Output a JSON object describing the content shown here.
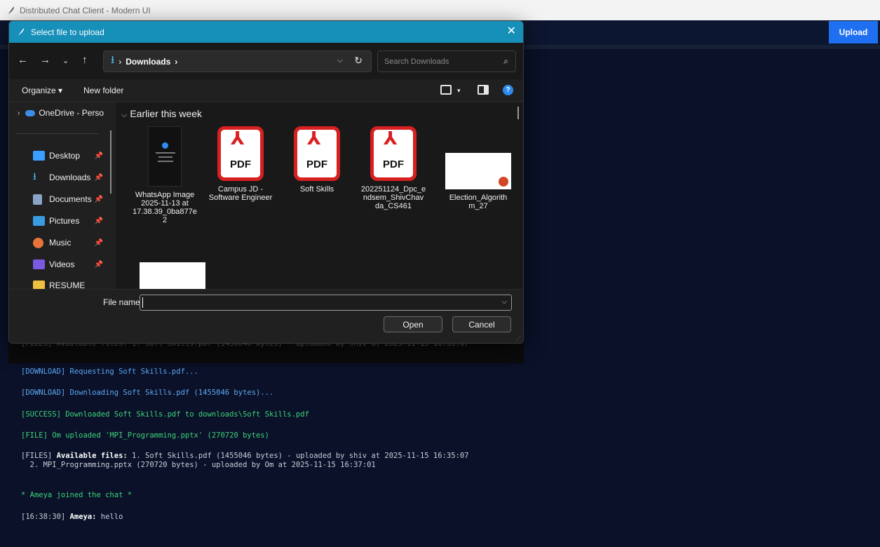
{
  "window": {
    "title": "Distributed Chat Client - Modern UI"
  },
  "app": {
    "upload_label": "Upload"
  },
  "dialog": {
    "title": "Select file to upload",
    "close": "✕",
    "address": {
      "folder": "Downloads",
      "sep_after": "›"
    },
    "search_placeholder": "Search Downloads",
    "commands": {
      "organize": "Organize ▾",
      "new_folder": "New folder"
    },
    "sidebar": [
      {
        "label": "OneDrive - Perso",
        "icon": "onedrive-icon",
        "color": "#3a8ee6"
      },
      {
        "label": "Desktop",
        "icon": "desktop-icon",
        "color": "#3aa0ff"
      },
      {
        "label": "Downloads",
        "icon": "download-icon",
        "color": "#4cc2ff"
      },
      {
        "label": "Documents",
        "icon": "documents-icon",
        "color": "#8aa4c8"
      },
      {
        "label": "Pictures",
        "icon": "pictures-icon",
        "color": "#3a9be0"
      },
      {
        "label": "Music",
        "icon": "music-icon",
        "color": "#e8743b"
      },
      {
        "label": "Videos",
        "icon": "videos-icon",
        "color": "#7a5ae0"
      },
      {
        "label": "RESUME",
        "icon": "folder-icon",
        "color": "#f0c040"
      }
    ],
    "group_header": "Earlier this week",
    "files": [
      {
        "name": "WhatsApp Image 2025-11-13 at 17.38.39_0ba877e 2",
        "kind": "image"
      },
      {
        "name": "Campus JD - Software Engineer",
        "kind": "pdf"
      },
      {
        "name": "Soft Skills",
        "kind": "pdf"
      },
      {
        "name": "202251124_Dpc_e ndsem_ShivChav da_CS461",
        "kind": "pdf"
      },
      {
        "name": "Election_Algorith m_27",
        "kind": "pptx"
      },
      {
        "name": "",
        "kind": "pptx"
      }
    ],
    "pdf_text": "PDF",
    "file_name_label": "File name:",
    "file_name_value": "",
    "open_label": "Open",
    "cancel_label": "Cancel"
  },
  "chat": {
    "faded_line": "[FILES] Available files: 1. Soft Skills.pdf (1455046 bytes) - uploaded by shiv at 2025-11-15 16:35:07",
    "lines": [
      {
        "text": "[DOWNLOAD] Requesting Soft Skills.pdf...",
        "type": "download"
      },
      {
        "text": "[DOWNLOAD] Downloading Soft Skills.pdf (1455046 bytes)...",
        "type": "download"
      },
      {
        "text": "[SUCCESS] Downloaded Soft Skills.pdf to downloads\\Soft Skills.pdf",
        "type": "success"
      },
      {
        "text": "[FILE] Om uploaded 'MPI_Programming.pptx' (270720 bytes)",
        "type": "success"
      }
    ],
    "files_prefix": "[FILES] ",
    "files_bold": "Available files:",
    "files_rest1": " 1. Soft Skills.pdf (1455046 bytes) - uploaded by shiv at 2025-11-15 16:35:07",
    "files_line2": "  2. MPI_Programming.pptx (270720 bytes) - uploaded by Om at 2025-11-15 16:37:01",
    "join": "* Ameya joined the chat *",
    "msg_time": "[16:38:30] ",
    "msg_user": "Ameya:",
    "msg_text": " hello"
  }
}
